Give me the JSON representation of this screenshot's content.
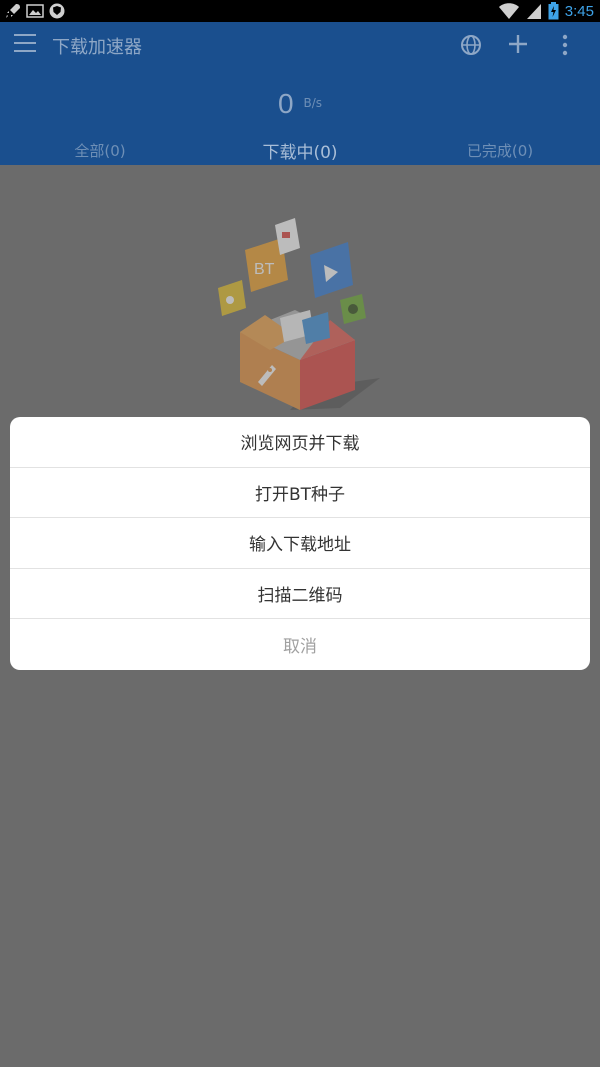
{
  "status_bar": {
    "time": "3:45",
    "left_icons": [
      "rocket-icon",
      "image-icon",
      "shield-icon"
    ],
    "right_icons": [
      "wifi-icon",
      "signal-icon",
      "battery-icon"
    ]
  },
  "header": {
    "title": "下载加速器",
    "speed_value": "0",
    "speed_unit": "B/s",
    "icons": [
      "menu-icon",
      "globe-icon",
      "plus-icon",
      "more-vert-icon"
    ]
  },
  "tabs": [
    {
      "label": "全部(0)",
      "active": false
    },
    {
      "label": "下载中(0)",
      "active": true
    },
    {
      "label": "已完成(0)",
      "active": false
    }
  ],
  "dialog": {
    "items": [
      {
        "label": "浏览网页并下载"
      },
      {
        "label": "打开BT种子"
      },
      {
        "label": "输入下载地址"
      },
      {
        "label": "扫描二维码"
      },
      {
        "label": "取消"
      }
    ]
  },
  "illustration": {
    "bt_label": "BT"
  },
  "colors": {
    "header_bg": "#1a4f8e",
    "scrim": "#6b6b6b",
    "dialog_bg": "#ffffff",
    "cancel_text": "#a0a0a0"
  }
}
